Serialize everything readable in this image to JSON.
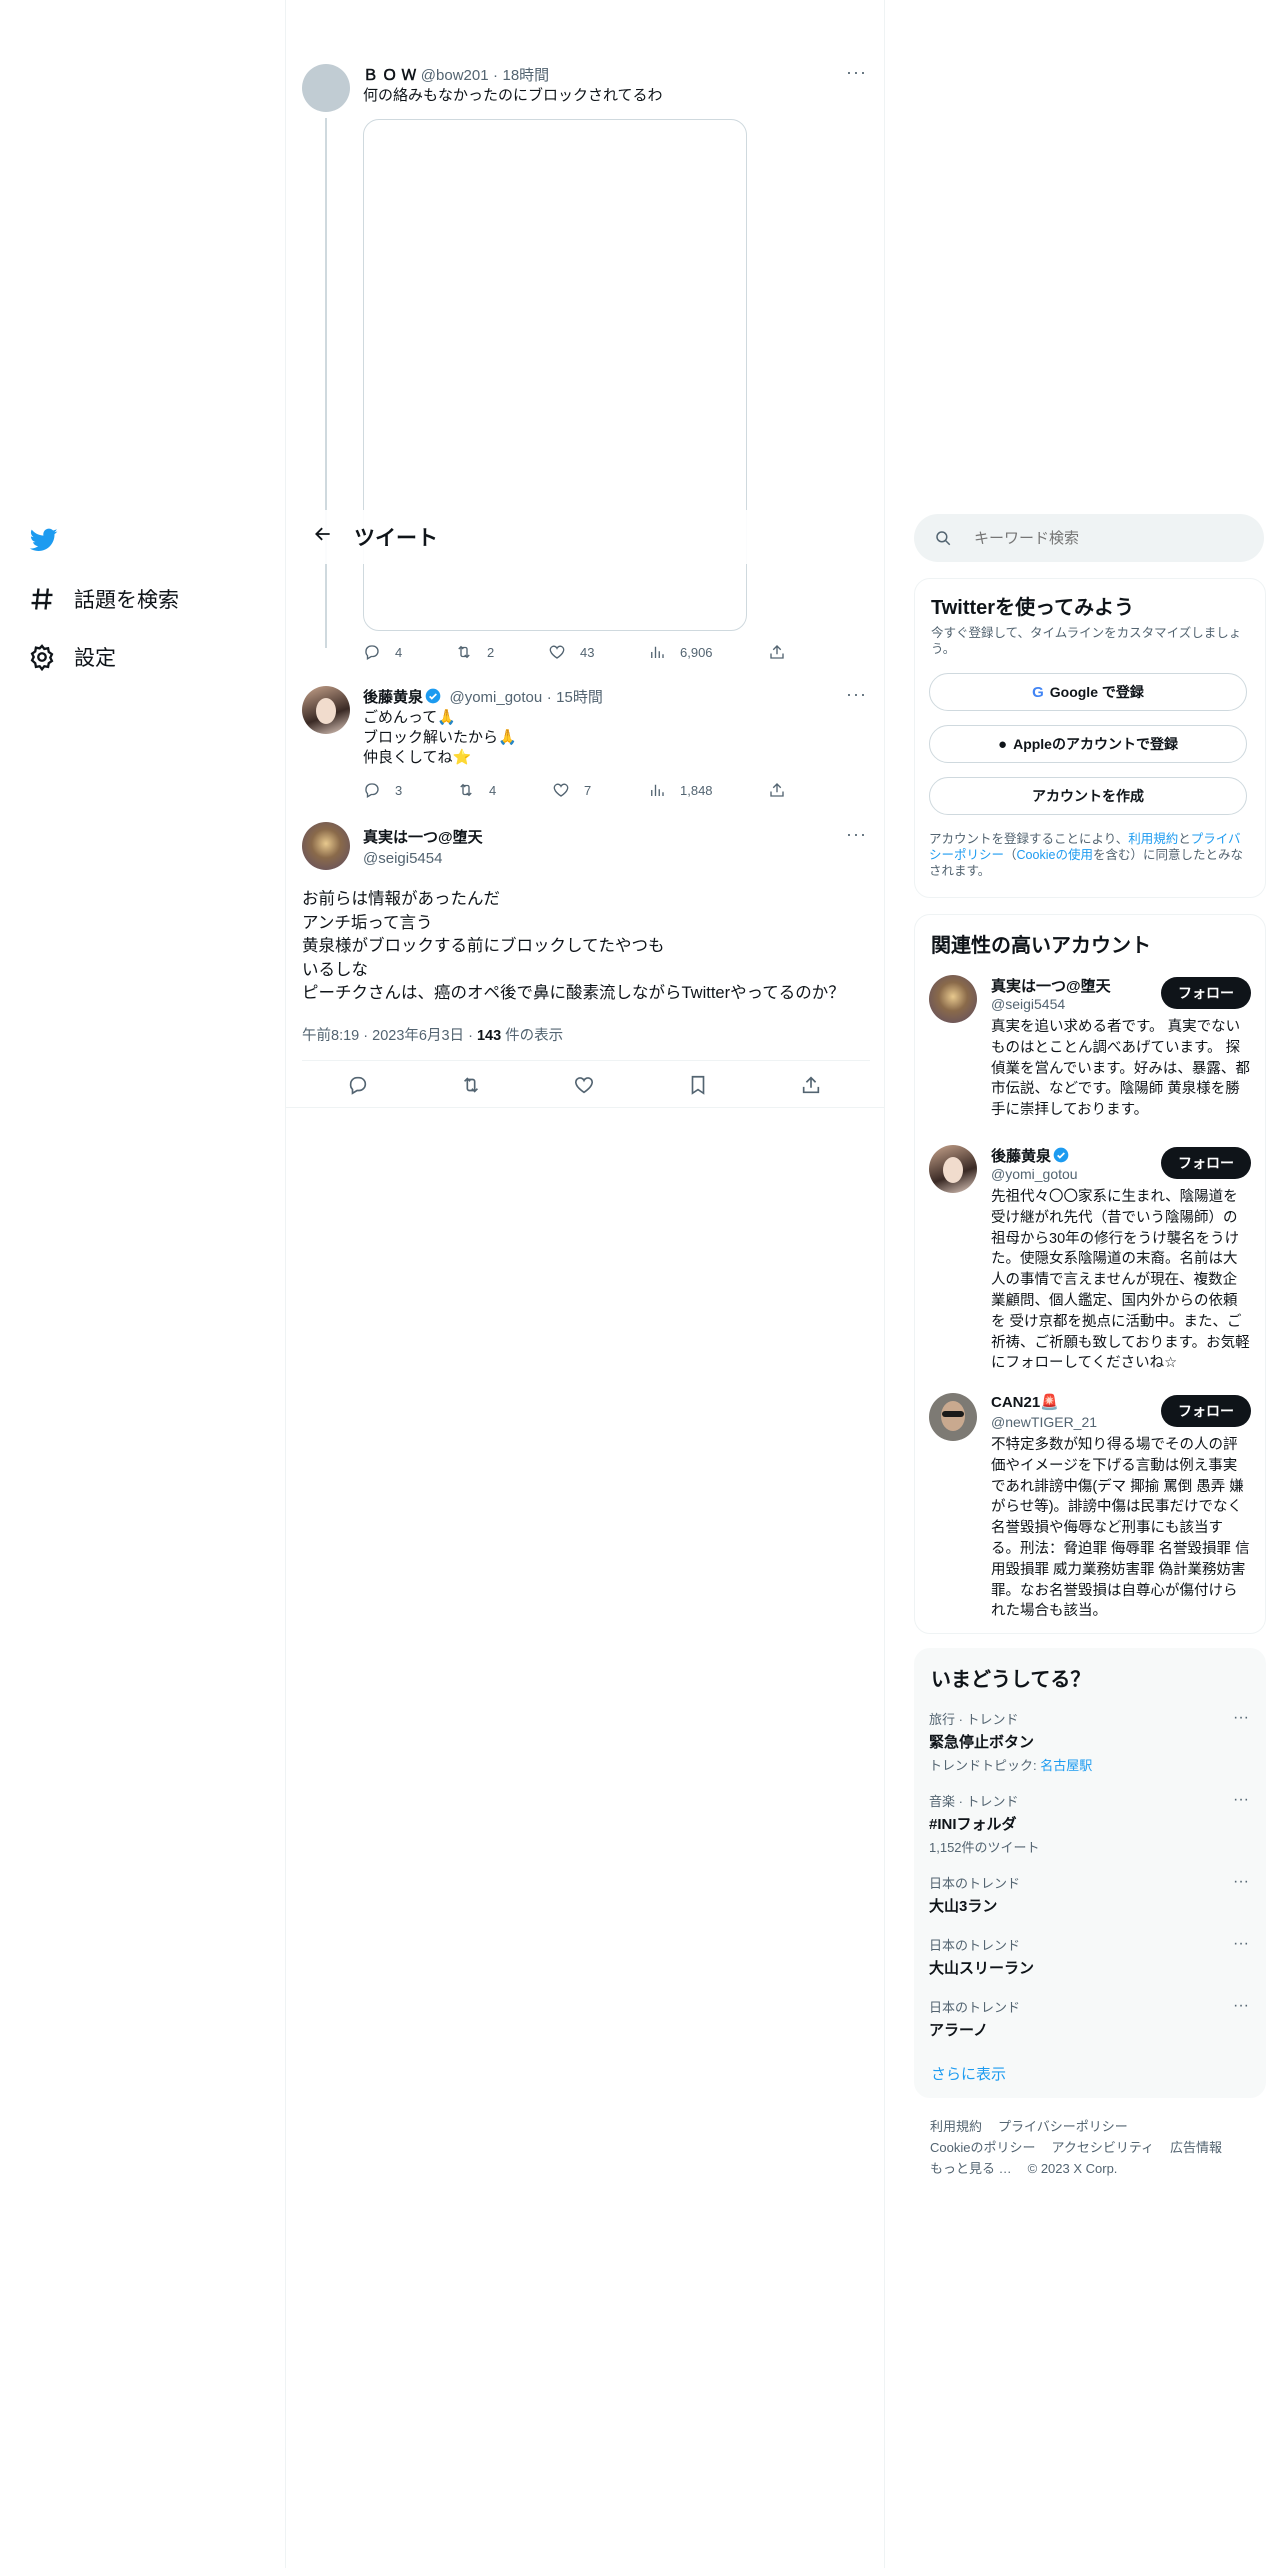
{
  "colors": {
    "accent": "#1d9bf0",
    "text": "#0f1419",
    "muted": "#536471",
    "border": "#eff3f4"
  },
  "nav": {
    "logo_icon": "twitter-bird-icon",
    "explore_label": "話題を検索",
    "settings_label": "設定"
  },
  "header": {
    "back_icon": "arrow-left-icon",
    "title": "ツイート"
  },
  "parent_tweet": {
    "display_name": "Ｂ Ｏ Ｗ",
    "handle": "@bow201",
    "dot": "·",
    "time": "18時間",
    "text": "何の絡みもなかったのにブロックされてるわ",
    "stats": {
      "replies": "4",
      "retweets": "2",
      "likes": "43",
      "views": "6,906"
    }
  },
  "reply_tweet": {
    "display_name": "後藤黄泉",
    "handle": "@yomi_gotou",
    "dot": "·",
    "time": "15時間",
    "lines": [
      "ごめんって🙏",
      "ブロック解いたから🙏",
      "仲良くしてね⭐"
    ],
    "stats": {
      "replies": "3",
      "retweets": "4",
      "likes": "7",
      "views": "1,848"
    }
  },
  "main_tweet": {
    "display_name": "真実は一つ@堕天",
    "handle": "@seigi5454",
    "lines": [
      "お前らは情報があったんだ",
      "アンチ垢って言う",
      "黄泉様がブロックする前にブロックしてたやつも",
      "いるしな",
      "ピーチクさんは、癌のオペ後で鼻に酸素流しながらTwitterやってるのか？"
    ],
    "time": "午前8:19",
    "dot1": "·",
    "date": "2023年6月3日",
    "dot2": "·",
    "views_count": "143",
    "views_label": "件の表示"
  },
  "search": {
    "placeholder": "キーワード検索"
  },
  "signup": {
    "title": "Twitterを使ってみよう",
    "subtitle": "今すぐ登録して、タイムラインをカスタマイズしましょう。",
    "google_button": "Google で登録",
    "apple_button": "Appleのアカウントで登録",
    "create_button": "アカウントを作成",
    "legal_prefix": "アカウントを登録することにより、",
    "legal_terms": "利用規約",
    "legal_and": "と",
    "legal_privacy": "プライバシーポリシー",
    "legal_mid": "（",
    "legal_cookie": "Cookieの使用",
    "legal_suffix": "を含む）に同意したとみなされます。"
  },
  "related": {
    "title": "関連性の高いアカウント",
    "follow_label": "フォロー",
    "accounts": [
      {
        "name": "真実は一つ@堕天",
        "handle": "@seigi5454",
        "bio": "真実を追い求める者です。 真実でないものはとことん調べあげています。 探偵業を営んでいます。好みは、暴露、都市伝説、などです。陰陽師 黄泉様を勝手に崇拝しております。"
      },
      {
        "name": "後藤黄泉",
        "handle": "@yomi_gotou",
        "bio": "先祖代々〇〇家系に生まれ、陰陽道を受け継がれ先代（昔でいう陰陽師）の祖母から30年の修行をうけ襲名をうけた。使隠女系陰陽道の末裔。名前は大人の事情で言えませんが現在、複数企業顧問、個人鑑定、国内外からの依頼を 受け京都を拠点に活動中。また、ご祈祷、ご祈願も致しております。お気軽にフォローしてくださいね☆"
      },
      {
        "name": "CAN21🚨",
        "handle": "@newTIGER_21",
        "bio": "不特定多数が知り得る場でその人の評価やイメージを下げる言動は例え事実であれ誹謗中傷(デマ 揶揄 罵倒 愚弄 嫌がらせ等)。誹謗中傷は民事だけでなく名誉毀損や侮辱など刑事にも該当する。刑法：脅迫罪 侮辱罪 名誉毀損罪 信用毀損罪 威力業務妨害罪 偽計業務妨害罪。なお名誉毀損は自尊心が傷付けられた場合も該当。"
      }
    ]
  },
  "trends": {
    "title": "いまどうしてる？",
    "items": [
      {
        "category": "旅行 · トレンド",
        "name": "緊急停止ボタン",
        "extra_prefix": "トレンドトピック: ",
        "extra_link": "名古屋駅"
      },
      {
        "category": "音楽 · トレンド",
        "name": "#INIフォルダ",
        "extra": "1,152件のツイート"
      },
      {
        "category": "日本のトレンド",
        "name": "大山3ラン"
      },
      {
        "category": "日本のトレンド",
        "name": "大山スリーラン"
      },
      {
        "category": "日本のトレンド",
        "name": "アラーノ"
      }
    ],
    "show_more": "さらに表示"
  },
  "footer": {
    "row1": [
      "利用規約",
      "プライバシーポリシー"
    ],
    "row2": [
      "Cookieのポリシー",
      "アクセシビリティ",
      "広告情報"
    ],
    "row3": [
      "もっと見る …",
      "© 2023 X Corp."
    ]
  }
}
